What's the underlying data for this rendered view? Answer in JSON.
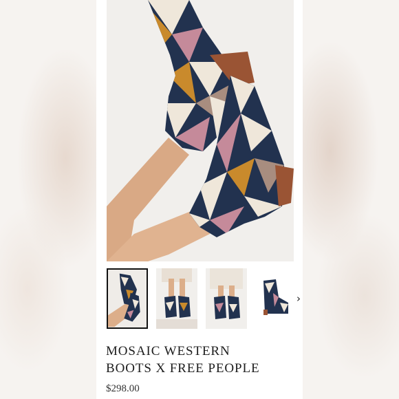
{
  "product": {
    "title_line1": "MOSAIC WESTERN",
    "title_line2": "BOOTS X FREE PEOPLE",
    "price": "$298.00"
  },
  "gallery": {
    "thumbnails": [
      {
        "name": "thumb-boots-legs-up",
        "selected": true
      },
      {
        "name": "thumb-model-standing-1",
        "selected": false
      },
      {
        "name": "thumb-model-standing-2",
        "selected": false
      },
      {
        "name": "thumb-single-boot",
        "selected": false
      }
    ],
    "next_icon": "chevron-right-icon",
    "next_glyph": "›"
  },
  "colors": {
    "navy": "#22324f",
    "cream": "#efe7da",
    "mauve": "#c58a9a",
    "mustard": "#c98a2c",
    "taupe": "#a88d7f",
    "heel": "#9a5434",
    "skin": "#dcae8a"
  }
}
